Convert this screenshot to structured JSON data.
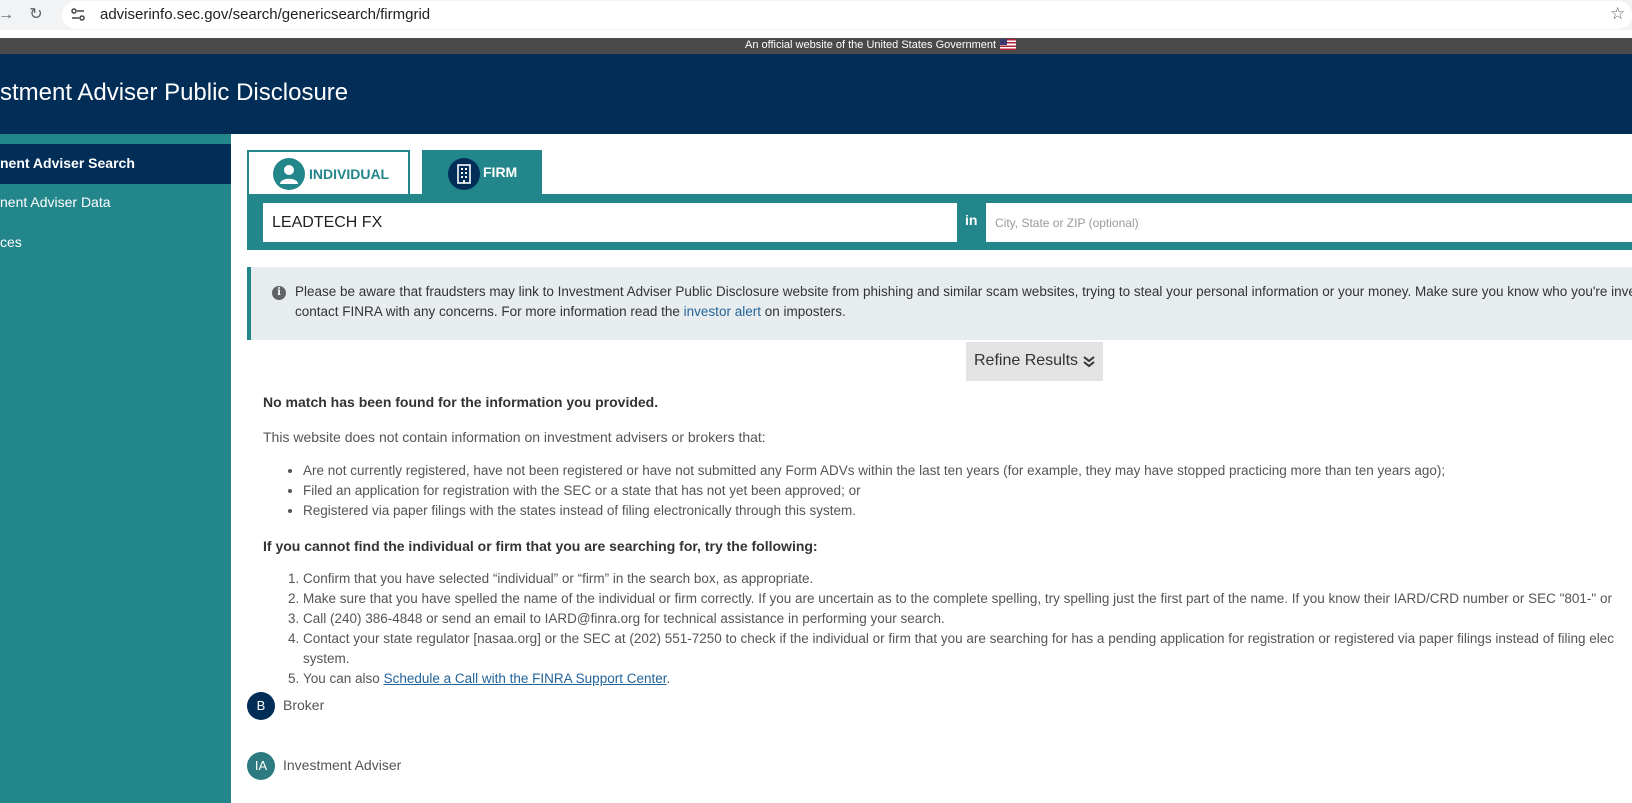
{
  "browser": {
    "url": "adviserinfo.sec.gov/search/genericsearch/firmgrid"
  },
  "gov_banner": {
    "text": "An official website of the United States Government"
  },
  "header": {
    "title": "stment Adviser Public Disclosure"
  },
  "sidebar": {
    "items": [
      {
        "label": "nent Adviser Search",
        "active": true
      },
      {
        "label": "nent Adviser Data",
        "active": false
      },
      {
        "label": "ces",
        "active": false
      }
    ]
  },
  "tabs": [
    {
      "label": "INDIVIDUAL",
      "icon": "person-icon",
      "selected": false
    },
    {
      "label": "FIRM",
      "icon": "building-icon",
      "selected": true
    }
  ],
  "search": {
    "value": "LEADTECH FX",
    "in_label": "in",
    "location_placeholder": "City, State or ZIP (optional)"
  },
  "alert": {
    "text_before_link": "Please be aware that fraudsters may link to Investment Adviser Public Disclosure website from phishing and similar scam websites, trying to steal your personal information or your money. Make sure you know who you're investing, and contact FINRA with any concerns. For more information read the ",
    "link_text": "investor alert",
    "text_after_link": " on imposters."
  },
  "refine": {
    "label": "Refine Results"
  },
  "results": {
    "no_match": "No match has been found for the information you provided.",
    "intro": "This website does not contain information on investment advisers or brokers that:",
    "notes": [
      "Are not currently registered, have not been registered or have not submitted any Form ADVs within the last ten years (for example, they may have stopped practicing more than ten years ago);",
      "Filed an application for registration with the SEC or a state that has not yet been approved; or",
      "Registered via paper filings with the states instead of filing electronically through this system."
    ],
    "try_heading": "If you cannot find the individual or firm that you are searching for, try the following:",
    "steps": [
      "Confirm that you have selected “individual” or “firm” in the search box, as appropriate.",
      "Make sure that you have spelled the name of the individual or firm correctly. If you are uncertain as to the complete spelling, try spelling just the first part of the name. If you know their IARD/CRD number or SEC \"801-\" or",
      "Call (240) 386-4848 or send an email to IARD@finra.org for technical assistance in performing your search.",
      "Contact your state regulator [nasaa.org] or the SEC at (202) 551-7250 to check if the individual or firm that you are searching for has a pending application for registration or registered via paper filings instead of filing elec system."
    ],
    "step5_prefix": "You can also ",
    "step5_link": "Schedule a Call with the FINRA Support Center",
    "step5_suffix": "."
  },
  "legend": [
    {
      "badge": "B",
      "label": "Broker",
      "color": "#022d57"
    },
    {
      "badge": "IA",
      "label": "Investment Adviser",
      "color": "#2d7a80"
    }
  ]
}
